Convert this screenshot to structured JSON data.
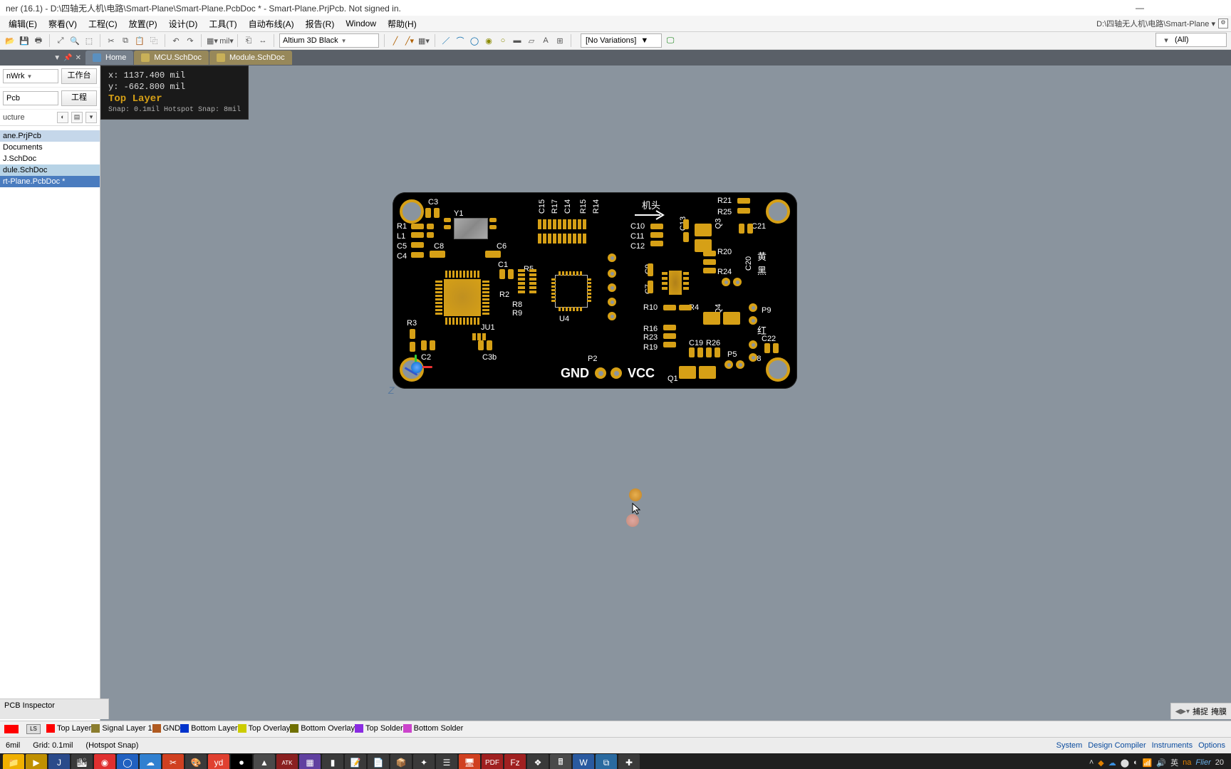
{
  "title": "ner (16.1) - D:\\四轴无人机\\电路\\Smart-Plane\\Smart-Plane.PcbDoc * - Smart-Plane.PrjPcb. Not signed in.",
  "pathbar": "D:\\四轴无人机\\电路\\Smart-Plane ▾",
  "menus": [
    "编辑(E)",
    "察看(V)",
    "工程(C)",
    "放置(P)",
    "设计(D)",
    "工具(T)",
    "自动布线(A)",
    "报告(R)",
    "Window",
    "帮助(H)"
  ],
  "toolbar": {
    "view_combo": "Altium 3D Black",
    "variations": "[No Variations]",
    "all": "(All)"
  },
  "crumbs": {
    "home": "Home",
    "mcu": "MCU.SchDoc",
    "module": "Module.SchDoc",
    "pcb": "Smart-Plane.PcbDoc *"
  },
  "side": {
    "combo1": "nWrk",
    "btn1": "工作台",
    "combo2": "Pcb",
    "btn2": "工程",
    "structure_label": "ucture",
    "tree": [
      "ane.PrjPcb",
      "Documents",
      "J.SchDoc",
      "dule.SchDoc",
      "rt-Plane.PcbDoc *"
    ]
  },
  "hud": {
    "x": "x:   1137.400  mil",
    "y": "y:   -662.800   mil",
    "layer": "Top Layer",
    "snap": "Snap: 0.1mil Hotspot Snap: 8mil"
  },
  "pcb_silk": {
    "nose": "机头",
    "gnd": "GND",
    "vcc": "VCC",
    "yellow": "黄",
    "black": "黑",
    "red": "红",
    "refs": [
      "C3",
      "Y1",
      "R1",
      "L1",
      "C5",
      "C4",
      "C8",
      "C6",
      "C1",
      "R5",
      "R2",
      "R8",
      "R9",
      "U4",
      "R3",
      "C2",
      "JU1",
      "C3b",
      "P2",
      "C15",
      "R17",
      "C14",
      "R15",
      "R14",
      "C10",
      "C11",
      "C12",
      "C9",
      "C7",
      "R10",
      "R16",
      "R23",
      "R19",
      "R4",
      "C19",
      "R26",
      "P5",
      "Q1",
      "R21",
      "R25",
      "C21",
      "R20",
      "R24",
      "C20",
      "Q3",
      "Q4",
      "P9",
      "C22",
      "P8",
      "C13"
    ]
  },
  "layerbar": {
    "ls_label": "LS",
    "layers": [
      {
        "name": "Top Layer",
        "color": "#ff0000"
      },
      {
        "name": "Signal Layer 1",
        "color": "#8b7d2e"
      },
      {
        "name": "GND",
        "color": "#b05a20"
      },
      {
        "name": "Bottom Layer",
        "color": "#0033cc"
      },
      {
        "name": "Top Overlay",
        "color": "#cccc00"
      },
      {
        "name": "Bottom Overlay",
        "color": "#707000"
      },
      {
        "name": "Top Solder",
        "color": "#8a2be2"
      },
      {
        "name": "Bottom Solder",
        "color": "#cc44cc"
      }
    ]
  },
  "inspector_tab": "PCB Inspector",
  "right_pins": {
    "p1": "捕捉",
    "p2": "掩膜"
  },
  "statusbar": {
    "left": [
      "6mil",
      "Grid: 0.1mil",
      "(Hotspot Snap)"
    ],
    "right": [
      "System",
      "Design Compiler",
      "Instruments",
      "Options"
    ]
  },
  "taskbar": {
    "ime": "英",
    "time": "20",
    "brand1": "na",
    "brand2": "Flier"
  },
  "z_label": "Z"
}
